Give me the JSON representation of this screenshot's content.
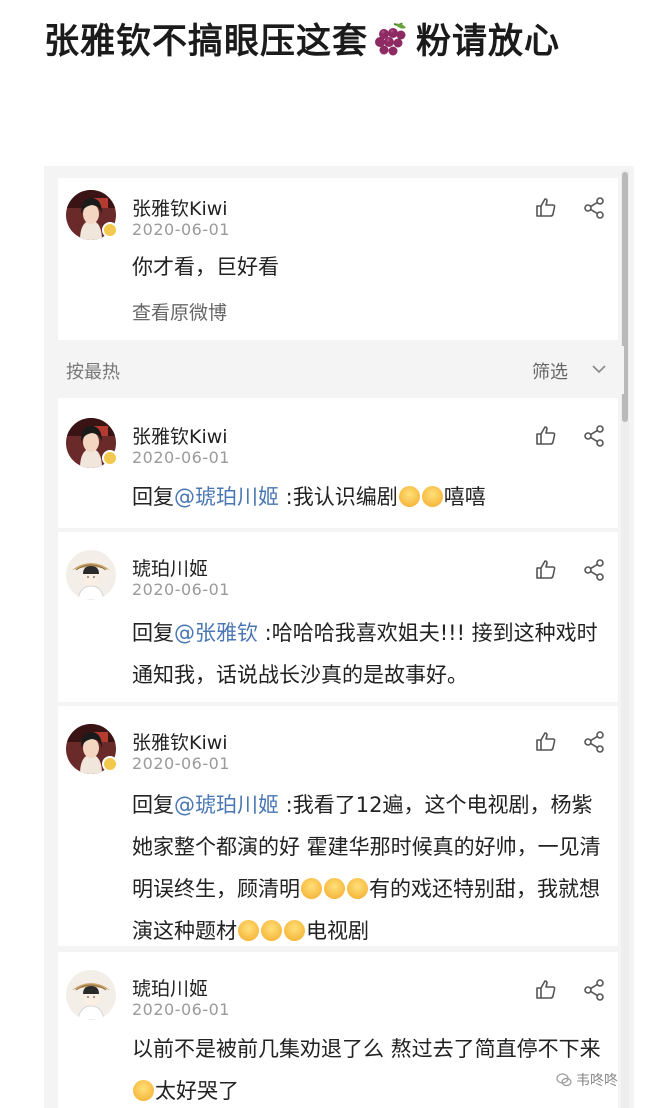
{
  "headline": {
    "text_before": "张雅钦不搞眼压这套",
    "emoji_name": "grapes-icon",
    "text_after": "粉请放心"
  },
  "post": {
    "author": "张雅钦Kiwi",
    "date": "2020-06-01",
    "text": "你才看，巨好看",
    "view_original": "查看原微博"
  },
  "sort_bar": {
    "sort_label": "按最热",
    "filter_label": "筛选"
  },
  "comments": [
    {
      "author": "张雅钦Kiwi",
      "date": "2020-06-01",
      "reply_prefix": "回复",
      "mention": "@琥珀川姬",
      "text": " :我认识编剧",
      "text_after": "嘻嘻"
    },
    {
      "author": "琥珀川姬",
      "date": "2020-06-01",
      "reply_prefix": "回复",
      "mention": "@张雅钦",
      "text": " :哈哈哈我喜欢姐夫!!! 接到这种戏时通知我，话说战长沙真的是故事好。"
    },
    {
      "author": "张雅钦Kiwi",
      "date": "2020-06-01",
      "reply_prefix": "回复",
      "mention": "@琥珀川姬",
      "text": " :我看了12遍，这个电视剧，杨紫她家整个都演的好 霍建华那时候真的好帅，一见清明误终生，顾清明",
      "text_mid": "有的戏还特别甜，我就想演这种题材",
      "text_after": "电视剧"
    },
    {
      "author": "琥珀川姬",
      "date": "2020-06-01",
      "text": "以前不是被前几集劝退了么 熬过去了简直停不下来",
      "text_after": "太好哭了"
    }
  ],
  "watermark": "韦咚咚",
  "colors": {
    "mention": "#4a77b4",
    "date": "#9a9a9a",
    "background": "#f4f4f4"
  }
}
